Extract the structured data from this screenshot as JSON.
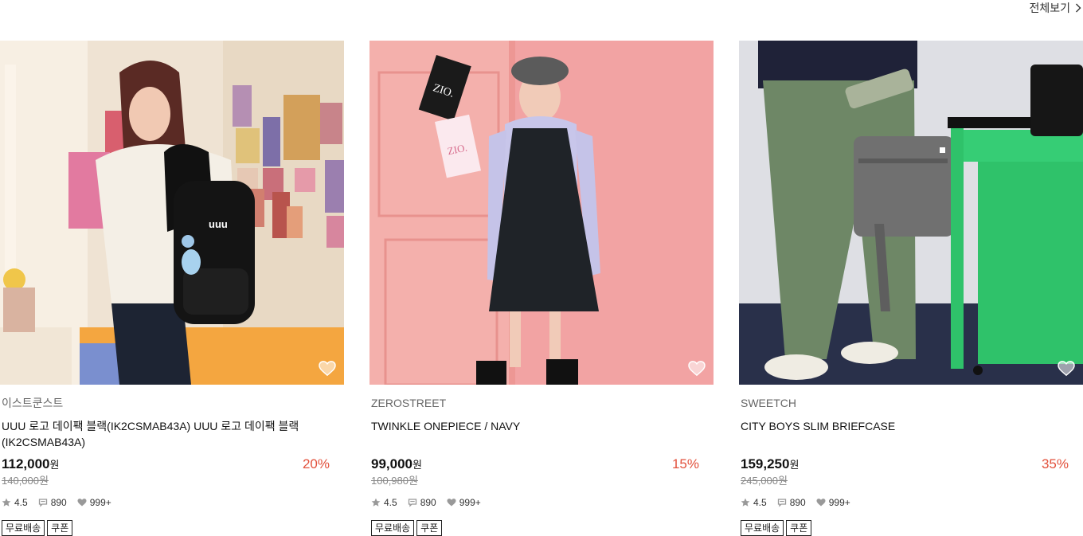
{
  "header": {
    "view_all_label": "전체보기"
  },
  "products": [
    {
      "brand": "이스트쿤스트",
      "name": "UUU 로고 데이팩 블랙(IK2CSMAB43A) UUU 로고 데이팩 블랙(IK2CSMAB43A)",
      "price": "112,000",
      "currency": "원",
      "discount": "20%",
      "original_price": "140,000원",
      "rating": "4.5",
      "reviews": "890",
      "likes": "999+",
      "tags": [
        "무료배송",
        "쿠폰"
      ],
      "bag_logo": "uuu"
    },
    {
      "brand": "ZEROSTREET",
      "name": "TWINKLE ONEPIECE / NAVY",
      "price": "99,000",
      "currency": "원",
      "discount": "15%",
      "original_price": "100,980원",
      "rating": "4.5",
      "reviews": "890",
      "likes": "999+",
      "tags": [
        "무료배송",
        "쿠폰"
      ],
      "poster_text": "ZIO."
    },
    {
      "brand": "SWEETCH",
      "name": "CITY BOYS SLIM BRIEFCASE",
      "price": "159,250",
      "currency": "원",
      "discount": "35%",
      "original_price": "245,000원",
      "rating": "4.5",
      "reviews": "890",
      "likes": "999+",
      "tags": [
        "무료배송",
        "쿠폰"
      ]
    }
  ],
  "colors": {
    "discount": "#e2513c",
    "desk_green": "#2fc26a",
    "pink_wall": "#f2a3a3"
  }
}
